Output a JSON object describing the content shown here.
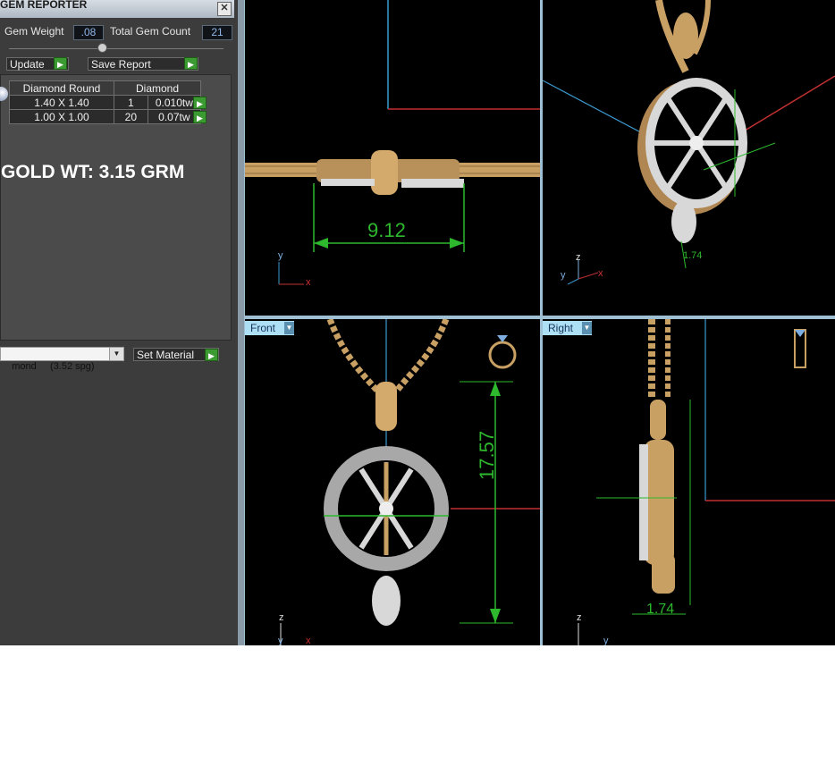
{
  "gem_reporter": {
    "title": "GEM REPORTER",
    "close": "✕",
    "gem_weight_label": "Gem Weight",
    "gem_weight_value": ".08",
    "total_gem_count_label": "Total Gem Count",
    "total_gem_count_value": "21",
    "update_label": "Update",
    "save_report_label": "Save Report",
    "table": {
      "headers": [
        "Diamond Round",
        "Diamond"
      ],
      "rows": [
        {
          "size": "1.40 X 1.40",
          "count": "1",
          "weight": "0.010tw"
        },
        {
          "size": "1.00 X 1.00",
          "count": "20",
          "weight": "0.07tw"
        }
      ]
    },
    "gold_weight": "GOLD WT: 3.15 GRM",
    "material_select": "mond     (3.52 spg)",
    "set_material_label": "Set Material"
  },
  "viewports": {
    "top_left": {
      "dimension": "9.12",
      "axis_y": "y",
      "axis_x": "x"
    },
    "top_right": {
      "dimension": "1.74",
      "axis_z": "z",
      "axis_y": "y",
      "axis_x": "x"
    },
    "bottom_left": {
      "tab": "Front",
      "dimension": "17.57",
      "axis_z": "z",
      "axis_y": "y",
      "axis_x": "x"
    },
    "bottom_right": {
      "tab": "Right",
      "dimension": "1.74",
      "axis_z": "z",
      "axis_y": "y"
    }
  },
  "colors": {
    "gold": "#c9a064",
    "silver": "#d8d8d8",
    "dimension_green": "#2eb82e",
    "panel_bg": "#3c3c3c"
  }
}
